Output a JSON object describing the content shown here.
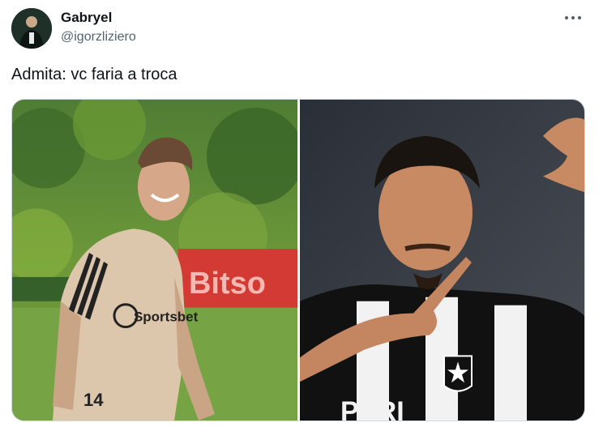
{
  "tweet": {
    "author": {
      "display_name": "Gabryel",
      "handle": "@igorzliziero",
      "avatar_icon": "user-avatar"
    },
    "more_icon": "more-options-icon",
    "text": "Admita: vc faria a troca",
    "media": [
      {
        "alt": "photo of smiling player in beige training shirt",
        "shirt_text": "Sportsbet",
        "number": "14",
        "banner_text": "Bitso"
      },
      {
        "alt": "photo of player in black and white striped shirt pointing",
        "shirt_text": "PARI"
      }
    ]
  },
  "colors": {
    "text": "#0f1419",
    "secondary_text": "#536471",
    "border": "#cfd9de"
  }
}
